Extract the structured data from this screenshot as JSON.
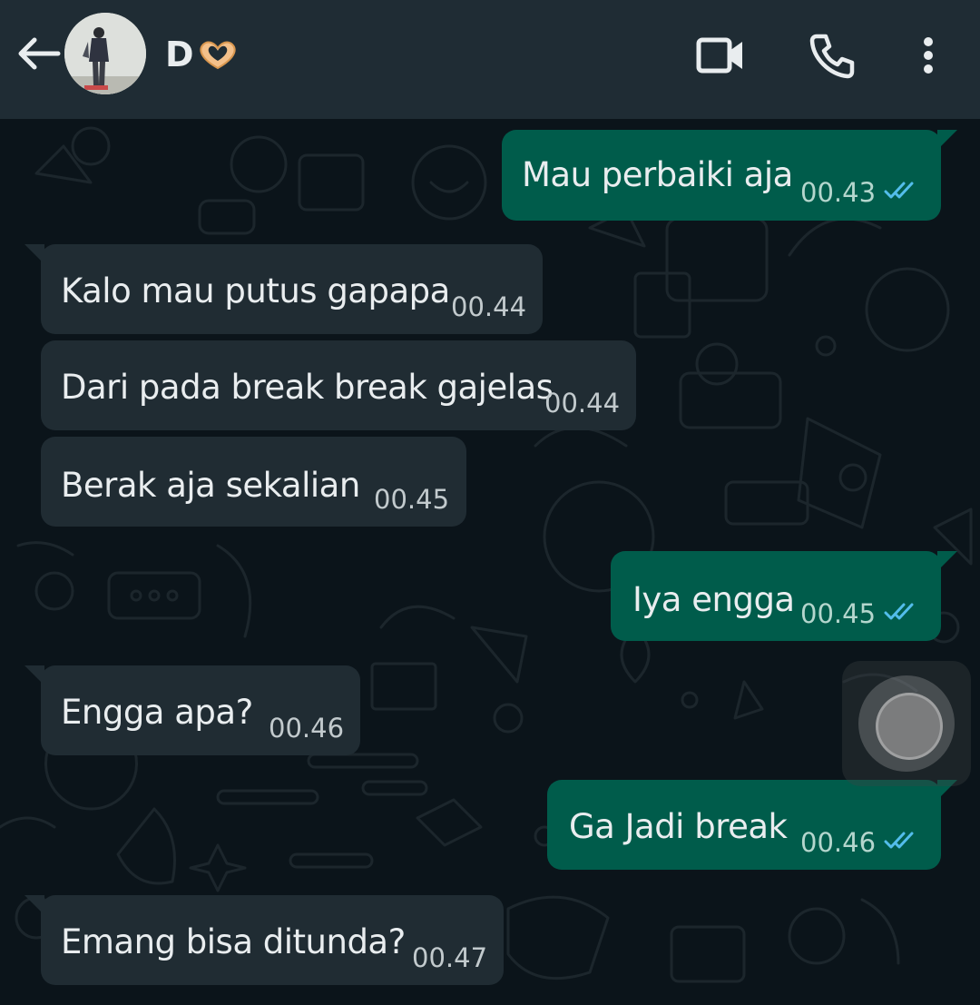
{
  "header": {
    "contact_name": "D",
    "icons": [
      "back-arrow-icon",
      "video-call-icon",
      "voice-call-icon",
      "more-options-icon"
    ]
  },
  "colors": {
    "header_bg": "#1f2c34",
    "chat_bg": "#0b141a",
    "incoming_bubble": "#202c33",
    "outgoing_bubble": "#005c4b",
    "read_tick": "#53bdeb"
  },
  "messages": [
    {
      "direction": "out",
      "text": "Mau perbaiki aja",
      "time": "00.43",
      "status": "read"
    },
    {
      "direction": "in",
      "text": "Kalo mau putus gapapa",
      "time": "00.44"
    },
    {
      "direction": "in",
      "text": "Dari pada break break gajelas",
      "time": "00.44"
    },
    {
      "direction": "in",
      "text": "Berak aja sekalian",
      "time": "00.45"
    },
    {
      "direction": "out",
      "text": "Iya engga",
      "time": "00.45",
      "status": "read"
    },
    {
      "direction": "in",
      "text": "Engga apa?",
      "time": "00.46"
    },
    {
      "direction": "out",
      "text": "Ga Jadi break",
      "time": "00.46",
      "status": "read"
    },
    {
      "direction": "in",
      "text": "Emang bisa ditunda?",
      "time": "00.47"
    }
  ]
}
